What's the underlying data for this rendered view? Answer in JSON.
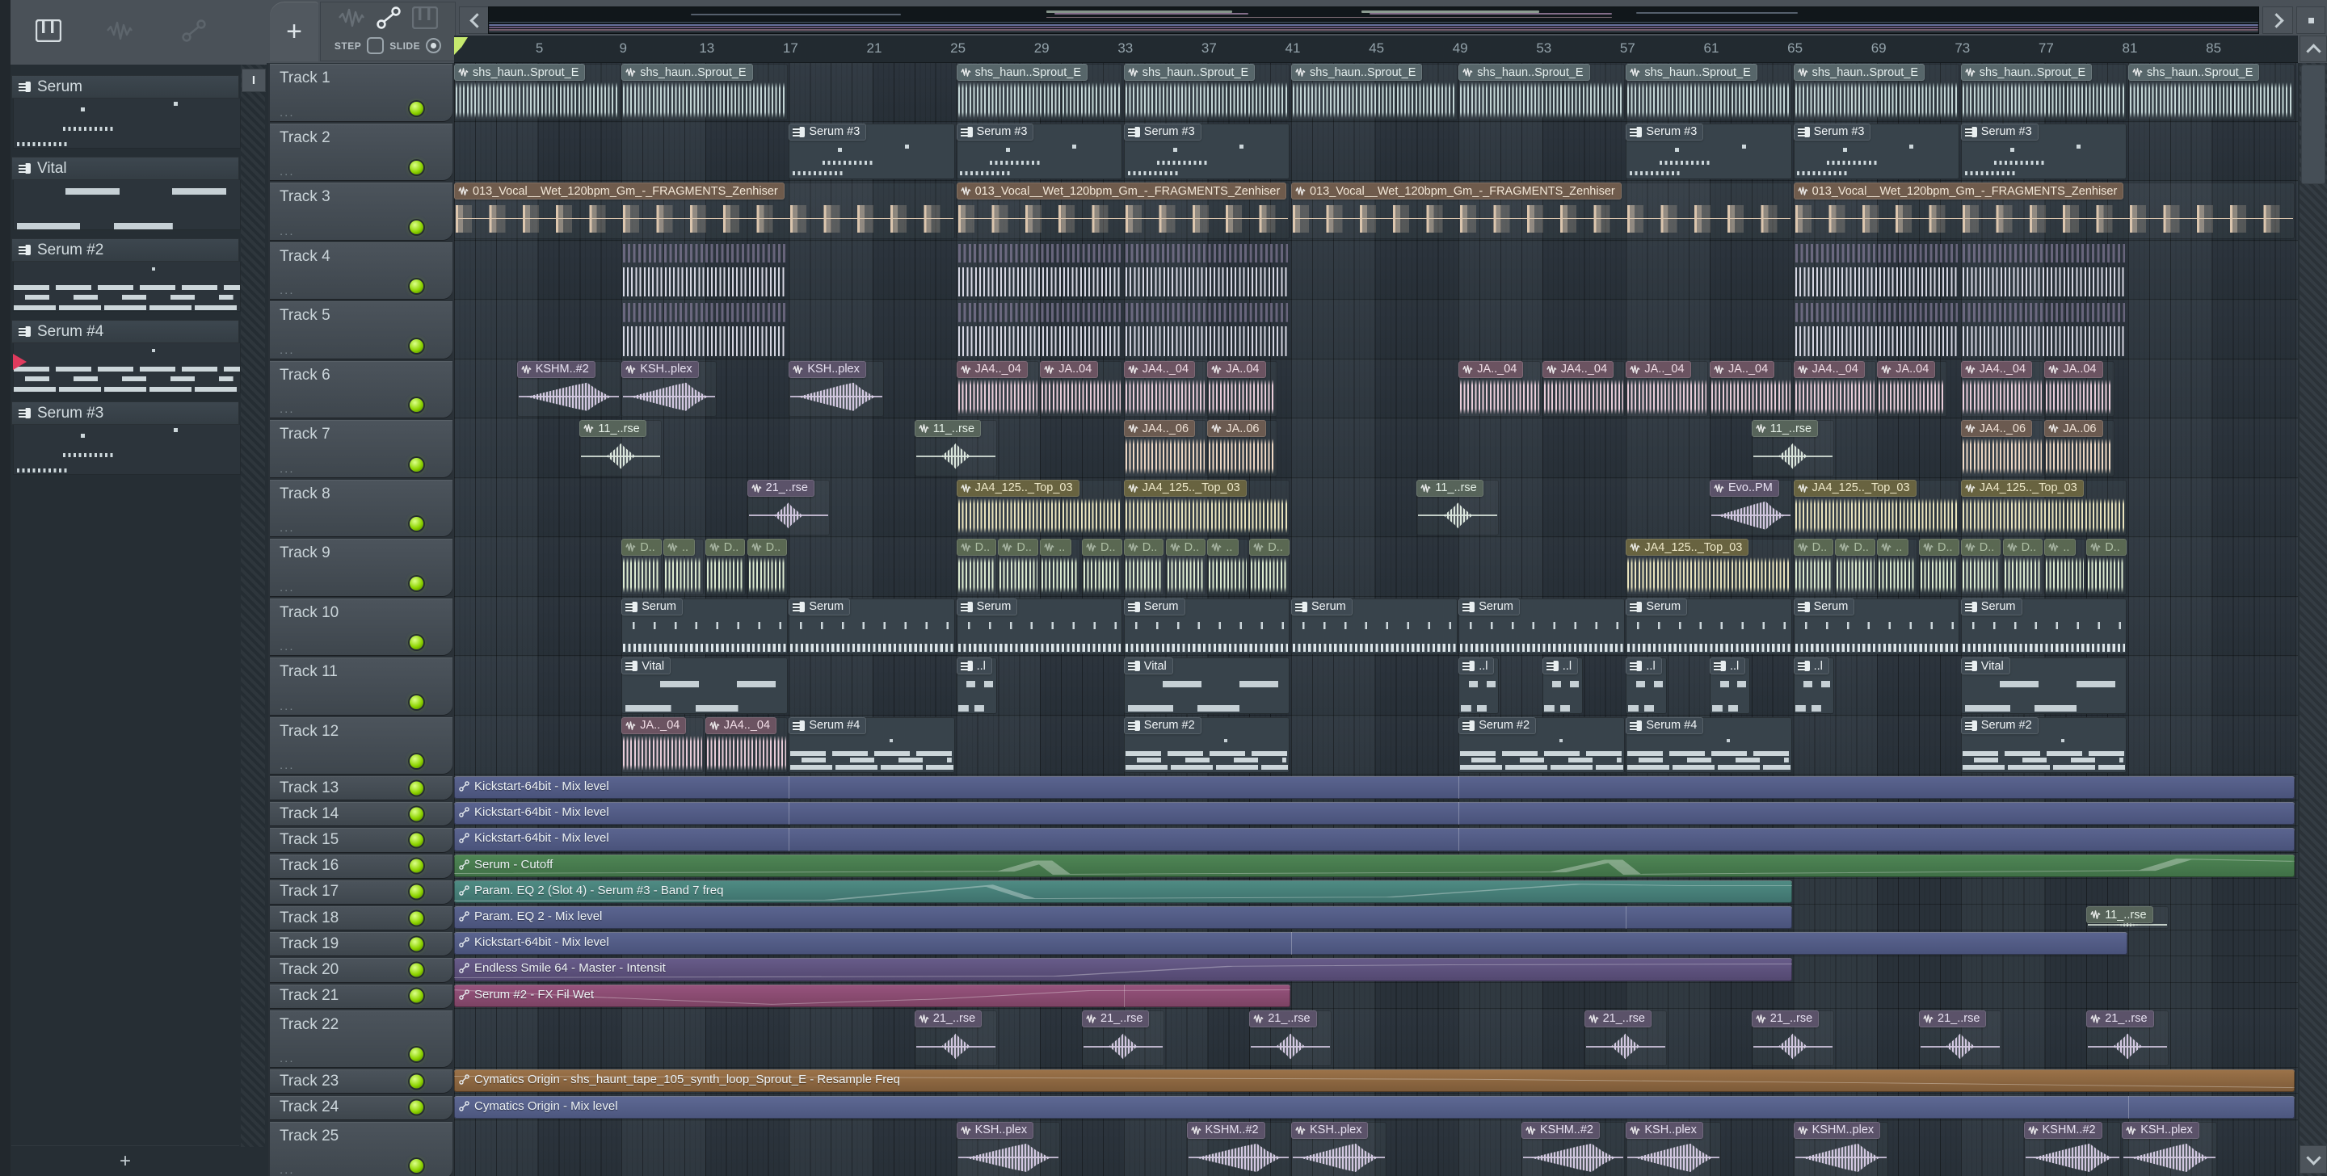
{
  "ui": {
    "add_tab": "+",
    "add_pattern": "+",
    "step": "STEP",
    "slide": "SLIDE",
    "picker": "I",
    "dots": "..."
  },
  "colors": {
    "led_green": "#8ed400",
    "playhead_green": "#c6e96e",
    "pattern_cursor_red": "#e03a5d",
    "auto_blue": "#545e88",
    "auto_green": "#477b4e",
    "auto_teal": "#47817a",
    "auto_purple": "#5d527d",
    "auto_pink": "#8a4b71",
    "auto_brown": "#8c6741",
    "grid_bg": "#2b343b",
    "header_bg": "#454d55"
  },
  "ruler": {
    "numbers": [
      5,
      9,
      13,
      17,
      21,
      25,
      29,
      33,
      37,
      41,
      45,
      49,
      53,
      57,
      61,
      65,
      69,
      73,
      77,
      81,
      85
    ]
  },
  "patterns": [
    {
      "name": "Serum",
      "prev": "serum3",
      "active": false
    },
    {
      "name": "Vital",
      "prev": "vital",
      "active": false
    },
    {
      "name": "Serum #2",
      "prev": "serum2",
      "active": false
    },
    {
      "name": "Serum #4",
      "prev": "serum2",
      "active": true
    },
    {
      "name": "Serum #3",
      "prev": "serum3",
      "active": false
    }
  ],
  "tracks": [
    {
      "name": "Track 1",
      "size": "tall"
    },
    {
      "name": "Track 2",
      "size": "tall"
    },
    {
      "name": "Track 3",
      "size": "tall"
    },
    {
      "name": "Track 4",
      "size": "tall"
    },
    {
      "name": "Track 5",
      "size": "tall"
    },
    {
      "name": "Track 6",
      "size": "tall"
    },
    {
      "name": "Track 7",
      "size": "tall"
    },
    {
      "name": "Track 8",
      "size": "tall"
    },
    {
      "name": "Track 9",
      "size": "tall"
    },
    {
      "name": "Track 10",
      "size": "tall"
    },
    {
      "name": "Track 11",
      "size": "tall"
    },
    {
      "name": "Track 12",
      "size": "tall"
    },
    {
      "name": "Track 13",
      "size": "compact"
    },
    {
      "name": "Track 14",
      "size": "compact"
    },
    {
      "name": "Track 15",
      "size": "compact"
    },
    {
      "name": "Track 16",
      "size": "compact"
    },
    {
      "name": "Track 17",
      "size": "compact"
    },
    {
      "name": "Track 18",
      "size": "compact"
    },
    {
      "name": "Track 19",
      "size": "compact"
    },
    {
      "name": "Track 20",
      "size": "compact"
    },
    {
      "name": "Track 21",
      "size": "compact"
    },
    {
      "name": "Track 22",
      "size": "tall"
    },
    {
      "name": "Track 23",
      "size": "compact"
    },
    {
      "name": "Track 24",
      "size": "compact"
    },
    {
      "name": "Track 25",
      "size": "tall"
    }
  ],
  "clips": [
    {
      "t": 1,
      "s": 1,
      "e": 9,
      "l": "shs_haun..Sprout_E",
      "k": "shs",
      "w": "dense"
    },
    {
      "t": 1,
      "s": 9,
      "e": 17,
      "l": "shs_haun..Sprout_E",
      "k": "shs",
      "w": "dense"
    },
    {
      "t": 1,
      "s": 25,
      "e": 33,
      "l": "shs_haun..Sprout_E",
      "k": "shs",
      "w": "dense"
    },
    {
      "t": 1,
      "s": 33,
      "e": 41,
      "l": "shs_haun..Sprout_E",
      "k": "shs",
      "w": "dense"
    },
    {
      "t": 1,
      "s": 41,
      "e": 49,
      "l": "shs_haun..Sprout_E",
      "k": "shs",
      "w": "dense"
    },
    {
      "t": 1,
      "s": 49,
      "e": 57,
      "l": "shs_haun..Sprout_E",
      "k": "shs",
      "w": "dense"
    },
    {
      "t": 1,
      "s": 57,
      "e": 65,
      "l": "shs_haun..Sprout_E",
      "k": "shs",
      "w": "dense"
    },
    {
      "t": 1,
      "s": 65,
      "e": 73,
      "l": "shs_haun..Sprout_E",
      "k": "shs",
      "w": "dense"
    },
    {
      "t": 1,
      "s": 73,
      "e": 81,
      "l": "shs_haun..Sprout_E",
      "k": "shs",
      "w": "dense"
    },
    {
      "t": 1,
      "s": 81,
      "e": 89,
      "l": "shs_haun..Sprout_E",
      "k": "shs",
      "w": "dense"
    },
    {
      "t": 2,
      "s": 17,
      "e": 25,
      "l": "Serum #3",
      "k": "midi",
      "p": "serum3"
    },
    {
      "t": 2,
      "s": 25,
      "e": 33,
      "l": "Serum #3",
      "k": "midi",
      "p": "serum3"
    },
    {
      "t": 2,
      "s": 33,
      "e": 41,
      "l": "Serum #3",
      "k": "midi",
      "p": "serum3"
    },
    {
      "t": 2,
      "s": 57,
      "e": 65,
      "l": "Serum #3",
      "k": "midi",
      "p": "serum3"
    },
    {
      "t": 2,
      "s": 65,
      "e": 73,
      "l": "Serum #3",
      "k": "midi",
      "p": "serum3"
    },
    {
      "t": 2,
      "s": 73,
      "e": 81,
      "l": "Serum #3",
      "k": "midi",
      "p": "serum3"
    },
    {
      "t": 3,
      "s": 1,
      "e": 25,
      "l": "013_Vocal__Wet_120bpm_Gm_-_FRAGMENTS_Zenhiser",
      "k": "vocal",
      "w": "vocal"
    },
    {
      "t": 3,
      "s": 25,
      "e": 41,
      "l": "013_Vocal__Wet_120bpm_Gm_-_FRAGMENTS_Zenhiser",
      "k": "vocal",
      "w": "vocal"
    },
    {
      "t": 3,
      "s": 41,
      "e": 65,
      "l": "013_Vocal__Wet_120bpm_Gm_-_FRAGMENTS_Zenhiser",
      "k": "vocal",
      "w": "vocal"
    },
    {
      "t": 3,
      "s": 65,
      "e": 89,
      "l": "013_Vocal__Wet_120bpm_Gm_-_FRAGMENTS_Zenhiser",
      "k": "vocal",
      "w": "vocal"
    },
    {
      "t": 4,
      "s": 9,
      "e": 17,
      "k": "stripes",
      "w": "stripes"
    },
    {
      "t": 4,
      "s": 25,
      "e": 33,
      "k": "stripes",
      "w": "stripes"
    },
    {
      "t": 4,
      "s": 33,
      "e": 41,
      "k": "stripes",
      "w": "stripes"
    },
    {
      "t": 4,
      "s": 65,
      "e": 73,
      "k": "stripes",
      "w": "stripes"
    },
    {
      "t": 4,
      "s": 73,
      "e": 81,
      "k": "stripes",
      "w": "stripes"
    },
    {
      "t": 5,
      "s": 9,
      "e": 17,
      "k": "stripes",
      "w": "stripes"
    },
    {
      "t": 5,
      "s": 25,
      "e": 33,
      "k": "stripes",
      "w": "stripes"
    },
    {
      "t": 5,
      "s": 33,
      "e": 41,
      "k": "stripes",
      "w": "stripes"
    },
    {
      "t": 5,
      "s": 65,
      "e": 73,
      "k": "stripes",
      "w": "stripes"
    },
    {
      "t": 5,
      "s": 73,
      "e": 81,
      "k": "stripes",
      "w": "stripes"
    },
    {
      "t": 6,
      "s": 4,
      "e": 9,
      "l": "KSHM..#2",
      "k": "riser",
      "w": "swell"
    },
    {
      "t": 6,
      "s": 9,
      "e": 13.6,
      "l": "KSH..plex",
      "k": "riser",
      "w": "swell"
    },
    {
      "t": 6,
      "s": 17,
      "e": 21.6,
      "l": "KSH..plex",
      "k": "riser",
      "w": "swell"
    },
    {
      "t": 6,
      "s": 25,
      "e": 29,
      "l": "JA4.._04",
      "k": "ja4",
      "w": "dense"
    },
    {
      "t": 6,
      "s": 29,
      "e": 33,
      "l": "JA..04",
      "k": "ja4",
      "w": "dense"
    },
    {
      "t": 6,
      "s": 33,
      "e": 37,
      "l": "JA4.._04",
      "k": "ja4",
      "w": "dense"
    },
    {
      "t": 6,
      "s": 37,
      "e": 40.4,
      "l": "JA..04",
      "k": "ja4",
      "w": "dense"
    },
    {
      "t": 6,
      "s": 49,
      "e": 53,
      "l": "JA.._04",
      "k": "ja4",
      "w": "dense"
    },
    {
      "t": 6,
      "s": 53,
      "e": 57,
      "l": "JA4.._04",
      "k": "ja4",
      "w": "dense"
    },
    {
      "t": 6,
      "s": 57,
      "e": 61,
      "l": "JA.._04",
      "k": "ja4",
      "w": "dense"
    },
    {
      "t": 6,
      "s": 61,
      "e": 65,
      "l": "JA.._04",
      "k": "ja4",
      "w": "dense"
    },
    {
      "t": 6,
      "s": 65,
      "e": 69,
      "l": "JA4.._04",
      "k": "ja4",
      "w": "dense"
    },
    {
      "t": 6,
      "s": 69,
      "e": 72.4,
      "l": "JA..04",
      "k": "ja4",
      "w": "dense"
    },
    {
      "t": 6,
      "s": 73,
      "e": 77,
      "l": "JA4.._04",
      "k": "ja4",
      "w": "dense"
    },
    {
      "t": 6,
      "s": 77,
      "e": 80.4,
      "l": "JA..04",
      "k": "ja4",
      "w": "dense"
    },
    {
      "t": 7,
      "s": 7,
      "e": 11,
      "l": "11_..rse",
      "k": "rse",
      "w": "burst"
    },
    {
      "t": 7,
      "s": 23,
      "e": 27,
      "l": "11_..rse",
      "k": "rse",
      "w": "burst"
    },
    {
      "t": 7,
      "s": 33,
      "e": 37,
      "l": "JA4.._06",
      "k": "ja6",
      "w": "dense"
    },
    {
      "t": 7,
      "s": 37,
      "e": 40.4,
      "l": "JA..06",
      "k": "ja6",
      "w": "dense"
    },
    {
      "t": 7,
      "s": 63,
      "e": 67,
      "l": "11_..rse",
      "k": "rse",
      "w": "burst"
    },
    {
      "t": 7,
      "s": 73,
      "e": 77,
      "l": "JA4.._06",
      "k": "ja6",
      "w": "dense"
    },
    {
      "t": 7,
      "s": 77,
      "e": 80.4,
      "l": "JA..06",
      "k": "ja6",
      "w": "dense"
    },
    {
      "t": 8,
      "s": 15,
      "e": 19,
      "l": "21_..rse",
      "k": "riser",
      "w": "burst"
    },
    {
      "t": 8,
      "s": 25,
      "e": 33,
      "l": "JA4_125.._Top_03",
      "k": "top03",
      "w": "dense"
    },
    {
      "t": 8,
      "s": 33,
      "e": 41,
      "l": "JA4_125.._Top_03",
      "k": "top03",
      "w": "dense"
    },
    {
      "t": 8,
      "s": 47,
      "e": 51,
      "l": "11_..rse",
      "k": "rse",
      "w": "burst"
    },
    {
      "t": 8,
      "s": 61,
      "e": 65,
      "l": "Evo..PM",
      "k": "riser",
      "w": "swell"
    },
    {
      "t": 8,
      "s": 65,
      "e": 73,
      "l": "JA4_125.._Top_03",
      "k": "top03",
      "w": "dense"
    },
    {
      "t": 8,
      "s": 73,
      "e": 81,
      "l": "JA4_125.._Top_03",
      "k": "top03",
      "w": "dense"
    },
    {
      "t": 9,
      "s": 9,
      "e": 11,
      "l": "D..",
      "k": "dgreen",
      "w": "dense"
    },
    {
      "t": 9,
      "s": 11,
      "e": 13,
      "l": "..",
      "k": "dgreen",
      "w": "dense"
    },
    {
      "t": 9,
      "s": 13,
      "e": 15,
      "l": "D..",
      "k": "dgreen",
      "w": "dense"
    },
    {
      "t": 9,
      "s": 15,
      "e": 17,
      "l": "D..",
      "k": "dgreen",
      "w": "dense"
    },
    {
      "t": 9,
      "s": 25,
      "e": 27,
      "l": "D..",
      "k": "dgreen",
      "w": "dense"
    },
    {
      "t": 9,
      "s": 27,
      "e": 29,
      "l": "D..",
      "k": "dgreen",
      "w": "dense"
    },
    {
      "t": 9,
      "s": 29,
      "e": 31,
      "l": "..",
      "k": "dgreen",
      "w": "dense"
    },
    {
      "t": 9,
      "s": 31,
      "e": 33,
      "l": "D..",
      "k": "dgreen",
      "w": "dense"
    },
    {
      "t": 9,
      "s": 33,
      "e": 35,
      "l": "D..",
      "k": "dgreen",
      "w": "dense"
    },
    {
      "t": 9,
      "s": 35,
      "e": 37,
      "l": "D..",
      "k": "dgreen",
      "w": "dense"
    },
    {
      "t": 9,
      "s": 37,
      "e": 39,
      "l": "..",
      "k": "dgreen",
      "w": "dense"
    },
    {
      "t": 9,
      "s": 39,
      "e": 41,
      "l": "D..",
      "k": "dgreen",
      "w": "dense"
    },
    {
      "t": 9,
      "s": 57,
      "e": 65,
      "l": "JA4_125.._Top_03",
      "k": "top03",
      "w": "dense"
    },
    {
      "t": 9,
      "s": 65,
      "e": 67,
      "l": "D..",
      "k": "dgreen",
      "w": "dense"
    },
    {
      "t": 9,
      "s": 67,
      "e": 69,
      "l": "D..",
      "k": "dgreen",
      "w": "dense"
    },
    {
      "t": 9,
      "s": 69,
      "e": 71,
      "l": "..",
      "k": "dgreen",
      "w": "dense"
    },
    {
      "t": 9,
      "s": 71,
      "e": 73,
      "l": "D..",
      "k": "dgreen",
      "w": "dense"
    },
    {
      "t": 9,
      "s": 73,
      "e": 75,
      "l": "D..",
      "k": "dgreen",
      "w": "dense"
    },
    {
      "t": 9,
      "s": 75,
      "e": 77,
      "l": "D..",
      "k": "dgreen",
      "w": "dense"
    },
    {
      "t": 9,
      "s": 77,
      "e": 79,
      "l": "..",
      "k": "dgreen",
      "w": "dense"
    },
    {
      "t": 9,
      "s": 79,
      "e": 81,
      "l": "D..",
      "k": "dgreen",
      "w": "dense"
    },
    {
      "t": 10,
      "s": 9,
      "e": 17,
      "l": "Serum",
      "k": "midi",
      "p": "serum"
    },
    {
      "t": 10,
      "s": 17,
      "e": 25,
      "l": "Serum",
      "k": "midi",
      "p": "serum"
    },
    {
      "t": 10,
      "s": 25,
      "e": 33,
      "l": "Serum",
      "k": "midi",
      "p": "serum"
    },
    {
      "t": 10,
      "s": 33,
      "e": 41,
      "l": "Serum",
      "k": "midi",
      "p": "serum"
    },
    {
      "t": 10,
      "s": 41,
      "e": 49,
      "l": "Serum",
      "k": "midi",
      "p": "serum"
    },
    {
      "t": 10,
      "s": 49,
      "e": 57,
      "l": "Serum",
      "k": "midi",
      "p": "serum"
    },
    {
      "t": 10,
      "s": 57,
      "e": 65,
      "l": "Serum",
      "k": "midi",
      "p": "serum"
    },
    {
      "t": 10,
      "s": 65,
      "e": 73,
      "l": "Serum",
      "k": "midi",
      "p": "serum"
    },
    {
      "t": 10,
      "s": 73,
      "e": 81,
      "l": "Serum",
      "k": "midi",
      "p": "serum"
    },
    {
      "t": 11,
      "s": 9,
      "e": 17,
      "l": "Vital",
      "k": "midi",
      "p": "vital"
    },
    {
      "t": 11,
      "s": 25,
      "e": 27,
      "l": "..l",
      "k": "midi",
      "p": "vital"
    },
    {
      "t": 11,
      "s": 33,
      "e": 41,
      "l": "Vital",
      "k": "midi",
      "p": "vital"
    },
    {
      "t": 11,
      "s": 49,
      "e": 51,
      "l": "..l",
      "k": "midi",
      "p": "vital"
    },
    {
      "t": 11,
      "s": 53,
      "e": 55,
      "l": "..l",
      "k": "midi",
      "p": "vital"
    },
    {
      "t": 11,
      "s": 57,
      "e": 59,
      "l": "..l",
      "k": "midi",
      "p": "vital"
    },
    {
      "t": 11,
      "s": 61,
      "e": 63,
      "l": "..l",
      "k": "midi",
      "p": "vital"
    },
    {
      "t": 11,
      "s": 65,
      "e": 67,
      "l": "..l",
      "k": "midi",
      "p": "vital"
    },
    {
      "t": 11,
      "s": 73,
      "e": 81,
      "l": "Vital",
      "k": "midi",
      "p": "vital"
    },
    {
      "t": 12,
      "s": 9,
      "e": 13,
      "l": "JA.._04",
      "k": "ja4",
      "w": "dense"
    },
    {
      "t": 12,
      "s": 13,
      "e": 17,
      "l": "JA4.._04",
      "k": "ja4",
      "w": "dense"
    },
    {
      "t": 12,
      "s": 17,
      "e": 25,
      "l": "Serum #4",
      "k": "midi",
      "p": "serum2"
    },
    {
      "t": 12,
      "s": 33,
      "e": 41,
      "l": "Serum #2",
      "k": "midi",
      "p": "serum2"
    },
    {
      "t": 12,
      "s": 49,
      "e": 57,
      "l": "Serum #2",
      "k": "midi",
      "p": "serum2"
    },
    {
      "t": 12,
      "s": 57,
      "e": 65,
      "l": "Serum #4",
      "k": "midi",
      "p": "serum2"
    },
    {
      "t": 12,
      "s": 73,
      "e": 81,
      "l": "Serum #2",
      "k": "midi",
      "p": "serum2"
    },
    {
      "t": 13,
      "s": 1,
      "e": 89,
      "l": "Kickstart-64bit - Mix level",
      "k": "ablue",
      "br": [
        17,
        49
      ]
    },
    {
      "t": 14,
      "s": 1,
      "e": 89,
      "l": "Kickstart-64bit - Mix level",
      "k": "ablue",
      "br": [
        17,
        49
      ]
    },
    {
      "t": 15,
      "s": 1,
      "e": 89,
      "l": "Kickstart-64bit - Mix level",
      "k": "ablue",
      "br": [
        17,
        49
      ]
    },
    {
      "t": 16,
      "s": 1,
      "e": 89,
      "l": "Serum - Cutoff",
      "k": "agreen"
    },
    {
      "t": 17,
      "s": 1,
      "e": 65,
      "l": "Param. EQ 2 (Slot 4) - Serum #3 - Band 7 freq",
      "k": "ateal"
    },
    {
      "t": 18,
      "s": 1,
      "e": 65,
      "l": "Param. EQ 2 - Mix level",
      "k": "ablue",
      "br": [
        57
      ]
    },
    {
      "t": 18,
      "s": 79,
      "e": 83,
      "l": "11_..rse",
      "k": "rse",
      "w": "burst"
    },
    {
      "t": 19,
      "s": 1,
      "e": 81,
      "l": "Kickstart-64bit - Mix level",
      "k": "ablue",
      "br": [
        41
      ]
    },
    {
      "t": 20,
      "s": 1,
      "e": 65,
      "l": "Endless Smile 64 - Master - Intensit",
      "k": "apurple"
    },
    {
      "t": 21,
      "s": 1,
      "e": 41,
      "l": "Serum #2 - FX Fil Wet",
      "k": "apink",
      "br": [
        33
      ]
    },
    {
      "t": 22,
      "s": 23,
      "e": 27,
      "l": "21_..rse",
      "k": "riser",
      "w": "burst"
    },
    {
      "t": 22,
      "s": 31,
      "e": 35,
      "l": "21_..rse",
      "k": "riser",
      "w": "burst"
    },
    {
      "t": 22,
      "s": 39,
      "e": 43,
      "l": "21_..rse",
      "k": "riser",
      "w": "burst"
    },
    {
      "t": 22,
      "s": 55,
      "e": 59,
      "l": "21_..rse",
      "k": "riser",
      "w": "burst"
    },
    {
      "t": 22,
      "s": 63,
      "e": 67,
      "l": "21_..rse",
      "k": "riser",
      "w": "burst"
    },
    {
      "t": 22,
      "s": 71,
      "e": 75,
      "l": "21_..rse",
      "k": "riser",
      "w": "burst"
    },
    {
      "t": 22,
      "s": 79,
      "e": 83,
      "l": "21_..rse",
      "k": "riser",
      "w": "burst"
    },
    {
      "t": 23,
      "s": 1,
      "e": 89,
      "l": "Cymatics Origin - shs_haunt_tape_105_synth_loop_Sprout_E - Resample Freq",
      "k": "abrown"
    },
    {
      "t": 24,
      "s": 1,
      "e": 89,
      "l": "Cymatics Origin - Mix level",
      "k": "aslate",
      "br": [
        81
      ]
    },
    {
      "t": 25,
      "s": 25,
      "e": 30,
      "l": "KSH..plex",
      "k": "riser",
      "w": "swell"
    },
    {
      "t": 25,
      "s": 36,
      "e": 41,
      "l": "KSHM..#2",
      "k": "riser",
      "w": "swell"
    },
    {
      "t": 25,
      "s": 41,
      "e": 45.6,
      "l": "KSH..plex",
      "k": "riser",
      "w": "swell"
    },
    {
      "t": 25,
      "s": 52,
      "e": 57,
      "l": "KSHM..#2",
      "k": "riser",
      "w": "swell"
    },
    {
      "t": 25,
      "s": 57,
      "e": 61.6,
      "l": "KSH..plex",
      "k": "riser",
      "w": "swell"
    },
    {
      "t": 25,
      "s": 65,
      "e": 69.6,
      "l": "KSHM..plex",
      "k": "riser",
      "w": "swell"
    },
    {
      "t": 25,
      "s": 76,
      "e": 80.7,
      "l": "KSHM..#2",
      "k": "riser",
      "w": "swell"
    },
    {
      "t": 25,
      "s": 80.7,
      "e": 85.3,
      "l": "KSH..plex",
      "k": "riser",
      "w": "swell"
    }
  ]
}
